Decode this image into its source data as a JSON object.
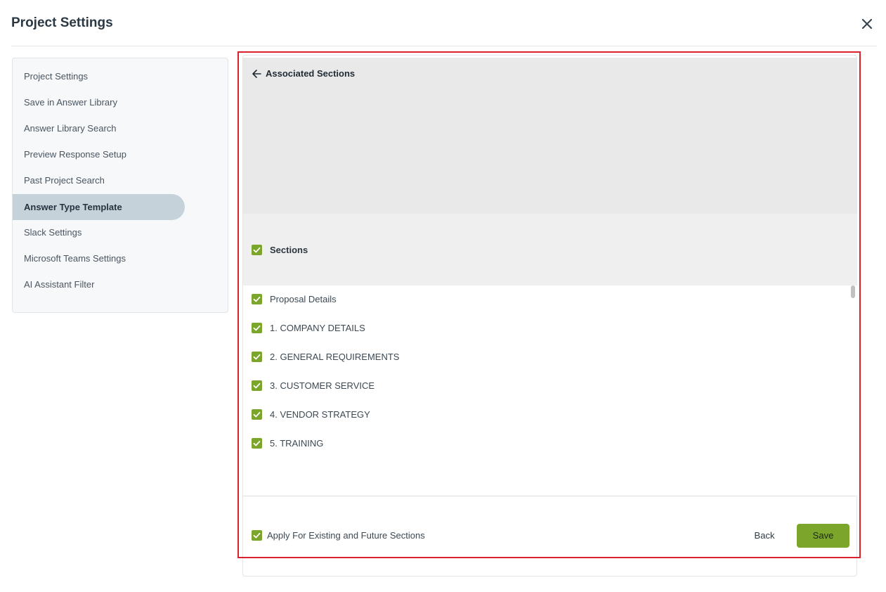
{
  "modal": {
    "title": "Project Settings",
    "close_icon": "close-icon"
  },
  "sidebar": {
    "items": [
      {
        "label": "Project Settings",
        "active": false
      },
      {
        "label": "Save in Answer Library",
        "active": false
      },
      {
        "label": "Answer Library Search",
        "active": false
      },
      {
        "label": "Preview Response Setup",
        "active": false
      },
      {
        "label": "Past Project Search",
        "active": false
      },
      {
        "label": "Answer Type Template",
        "active": true
      },
      {
        "label": "Slack Settings",
        "active": false
      },
      {
        "label": "Microsoft Teams Settings",
        "active": false
      },
      {
        "label": "AI Assistant Filter",
        "active": false
      }
    ]
  },
  "panel": {
    "back_icon": "arrow-left-icon",
    "title": "Associated Sections",
    "sections_header": {
      "label": "Sections",
      "checked": true
    },
    "sections": [
      {
        "label": "Proposal Details",
        "checked": true
      },
      {
        "label": "1. COMPANY DETAILS",
        "checked": true
      },
      {
        "label": "2. GENERAL REQUIREMENTS",
        "checked": true
      },
      {
        "label": "3. CUSTOMER SERVICE",
        "checked": true
      },
      {
        "label": "4. VENDOR STRATEGY",
        "checked": true
      },
      {
        "label": "5. TRAINING",
        "checked": true
      }
    ],
    "apply_all": {
      "label": "Apply For Existing and Future Sections",
      "checked": true
    },
    "back_label": "Back",
    "save_label": "Save"
  },
  "colors": {
    "accent_green": "#7ba52b",
    "highlight_red": "#d9222e",
    "active_nav": "#c5d2da"
  }
}
